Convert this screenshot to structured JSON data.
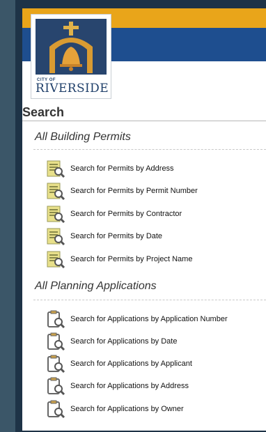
{
  "logo": {
    "city_of": "CITY OF",
    "name": "RIVERSIDE"
  },
  "section": {
    "title": "Search"
  },
  "building": {
    "title": "All Building Permits",
    "icon": "document-search-icon",
    "links": [
      "Search for Permits by Address",
      "Search for Permits by Permit Number",
      "Search for Permits by Contractor",
      "Search for Permits by Date",
      "Search for Permits by Project Name"
    ]
  },
  "planning": {
    "title": "All Planning Applications",
    "icon": "clipboard-search-icon",
    "links": [
      "Search for Applications by Application Number",
      "Search for Applications by Date",
      "Search for Applications by Applicant",
      "Search for Applications by Address",
      "Search for Applications by Owner"
    ]
  },
  "colors": {
    "gold_bar": "#e9a51a",
    "blue_bar": "#1e4e8f",
    "frame": "#1e3347",
    "background": "#3b5668"
  }
}
